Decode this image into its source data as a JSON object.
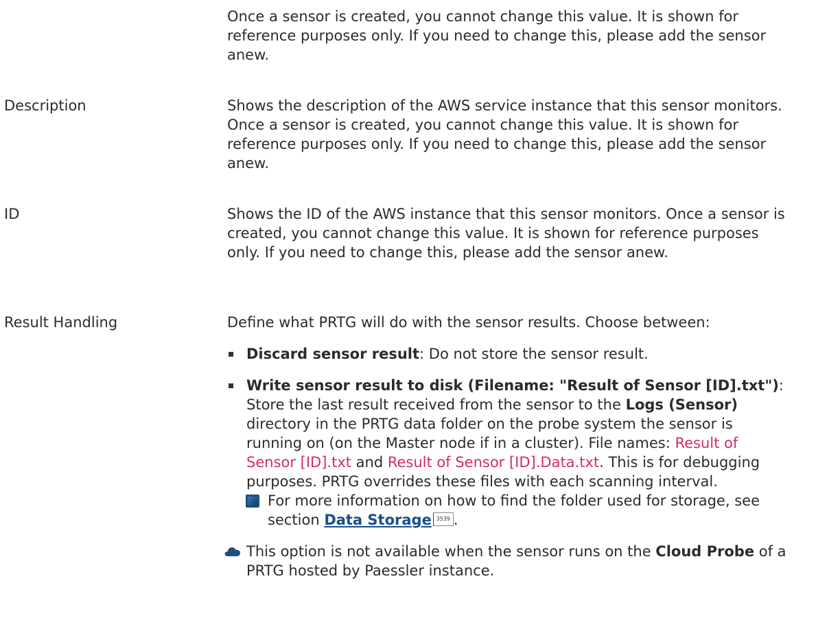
{
  "intro": {
    "text": " Once a sensor is created, you cannot change this value. It is shown for reference purposes only. If you need to change this, please add the sensor anew."
  },
  "rows": [
    {
      "label": "Description",
      "text": "Shows the description of the AWS service instance that this sensor monitors. Once a sensor is created, you cannot change this value. It is shown for reference purposes only. If you need to change this, please add the sensor anew."
    },
    {
      "label": "ID",
      "text": "Shows the ID of the AWS instance that this sensor monitors.  Once a sensor is created, you cannot change this value. It is shown for reference purposes only. If you need to change this, please add the sensor anew."
    }
  ],
  "result_handling": {
    "label": "Result Handling",
    "intro": "Define what PRTG will do with the sensor results. Choose between:",
    "opt1_bold": "Discard sensor result",
    "opt1_text": ": Do not store the sensor result.",
    "opt2_bold": "Write sensor result to disk (Filename: \"Result of Sensor [ID].txt\")",
    "opt2_text_a": ": Store the last result received from the sensor to the ",
    "opt2_logs": "Logs (Sensor)",
    "opt2_text_b": " directory in the PRTG data folder on the probe system the sensor is running on (on the Master node if in a cluster). File names: ",
    "opt2_file1": "Result of Sensor [ID].txt",
    "opt2_and": " and ",
    "opt2_file2": "Result of Sensor [ID].Data.txt",
    "opt2_text_c": ". This is for debugging purposes. PRTG overrides these files with each scanning interval.",
    "note_text": "For more information on how to find the folder used for storage, see section ",
    "note_link": "Data Storage",
    "note_page": "3539",
    "note_end": ".",
    "cloud_text_a": "This option is not available when the sensor runs on the ",
    "cloud_bold": "Cloud Probe",
    "cloud_text_b": " of a PRTG hosted by Paessler instance."
  },
  "icons": [
    "bullet-square",
    "book-icon",
    "cloud-icon"
  ]
}
